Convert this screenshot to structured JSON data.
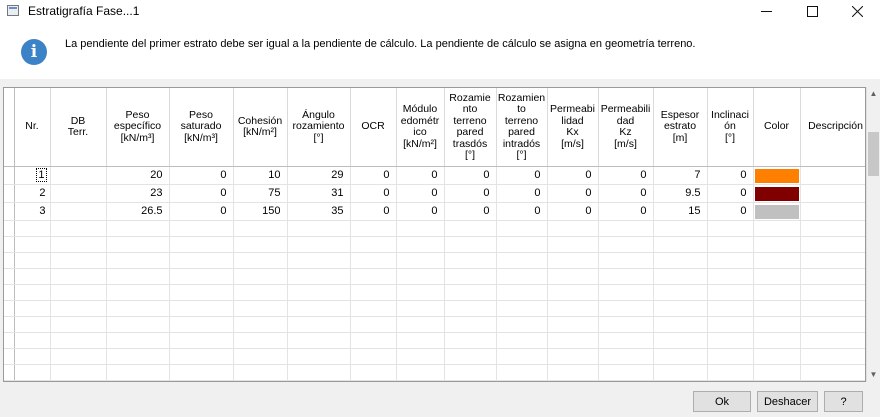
{
  "window": {
    "title": "Estratigrafía Fase...1",
    "icons": {
      "minimize": "minimize-icon",
      "maximize": "maximize-icon",
      "close": "close-icon"
    }
  },
  "info": {
    "icon": "info-icon",
    "icon_glyph": "i",
    "message": "La pendiente del primer estrato debe ser  igual a la pendiente de cálculo. La pendiente de cálculo se asigna en geometría terreno."
  },
  "table": {
    "columns": [
      "Nr.",
      "DB\nTerr.",
      "Peso\nespecífico\n[kN/m³]",
      "Peso\nsaturado\n[kN/m³]",
      "Cohesión\n[kN/m²]",
      "Ángulo\nrozamiento\n[°]",
      "OCR",
      "Módulo\nedométr\nico\n[kN/m²]",
      "Rozamie\nnto\nterreno\npared\ntrasdós\n[°]",
      "Rozamien\nto\nterreno\npared\nintradós\n[°]",
      "Permeabi\nlidad\nKx\n[m/s]",
      "Permeabili\ndad\nKz\n[m/s]",
      "Espesor\nestrato\n[m]",
      "Inclinaci\nón\n[°]",
      "Color",
      "Descripción"
    ],
    "rows": [
      {
        "nr": "1",
        "db": "",
        "peso_esp": "20",
        "peso_sat": "0",
        "cohesion": "10",
        "angulo": "29",
        "ocr": "0",
        "modulo": "0",
        "roz_tras": "0",
        "roz_intr": "0",
        "kx": "0",
        "kz": "0",
        "espesor": "7",
        "inclinacion": "0",
        "color": "#ff8000",
        "descripcion": ""
      },
      {
        "nr": "2",
        "db": "",
        "peso_esp": "23",
        "peso_sat": "0",
        "cohesion": "75",
        "angulo": "31",
        "ocr": "0",
        "modulo": "0",
        "roz_tras": "0",
        "roz_intr": "0",
        "kx": "0",
        "kz": "0",
        "espesor": "9.5",
        "inclinacion": "0",
        "color": "#800000",
        "descripcion": ""
      },
      {
        "nr": "3",
        "db": "",
        "peso_esp": "26.5",
        "peso_sat": "0",
        "cohesion": "150",
        "angulo": "35",
        "ocr": "0",
        "modulo": "0",
        "roz_tras": "0",
        "roz_intr": "0",
        "kx": "0",
        "kz": "0",
        "espesor": "15",
        "inclinacion": "0",
        "color": "#c0c0c0",
        "descripcion": ""
      }
    ],
    "empty_rows": 12
  },
  "buttons": {
    "ok": "Ok",
    "undo": "Deshacer",
    "help": "?"
  }
}
